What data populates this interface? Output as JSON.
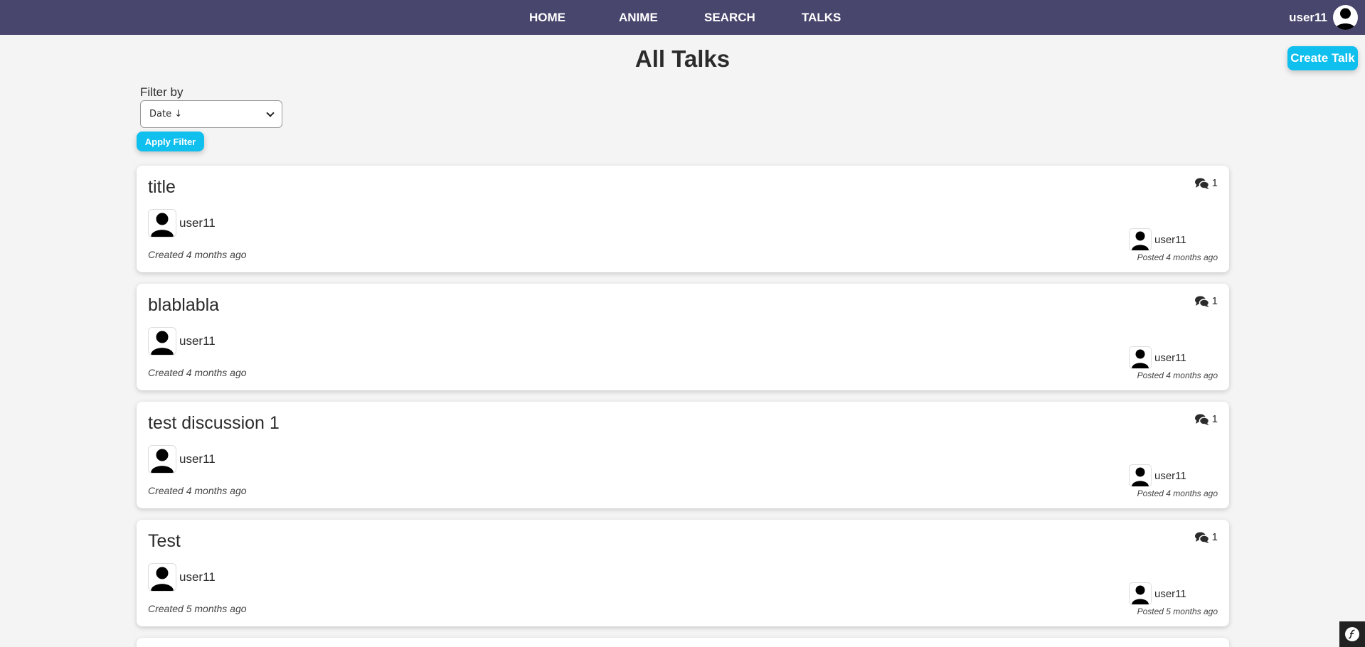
{
  "nav": {
    "links": [
      "HOME",
      "ANIME",
      "SEARCH",
      "TALKS"
    ],
    "user_name": "user11",
    "avatar_icon": "user-avatar-icon"
  },
  "header": {
    "title": "All Talks",
    "create_button": "Create Talk"
  },
  "filter": {
    "label": "Filter by",
    "selected": "Date ↓",
    "apply_button": "Apply Filter"
  },
  "talks": [
    {
      "title": "title",
      "author": "user11",
      "created": "Created 4 months ago",
      "comment_count": "1",
      "last_author": "user11",
      "posted": "Posted 4 months ago"
    },
    {
      "title": "blablabla",
      "author": "user11",
      "created": "Created 4 months ago",
      "comment_count": "1",
      "last_author": "user11",
      "posted": "Posted 4 months ago"
    },
    {
      "title": "test discussion 1",
      "author": "user11",
      "created": "Created 4 months ago",
      "comment_count": "1",
      "last_author": "user11",
      "posted": "Posted 4 months ago"
    },
    {
      "title": "Test",
      "author": "user11",
      "created": "Created 5 months ago",
      "comment_count": "1",
      "last_author": "user11",
      "posted": "Posted 5 months ago"
    }
  ],
  "colors": {
    "navbar": "#48466d",
    "accent": "#0fbfee",
    "background": "#f4f4f4"
  }
}
